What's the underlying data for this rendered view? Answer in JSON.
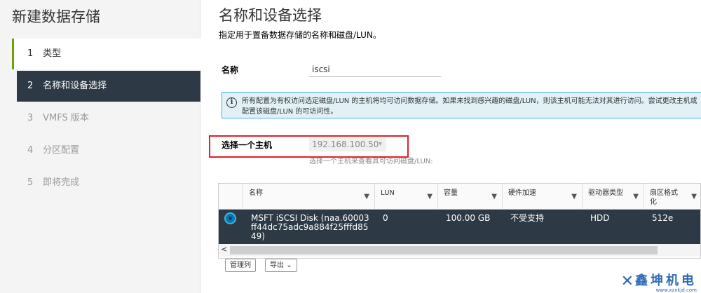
{
  "wizard": {
    "title": "新建数据存储",
    "steps": [
      {
        "num": "1",
        "label": "类型"
      },
      {
        "num": "2",
        "label": "名称和设备选择"
      },
      {
        "num": "3",
        "label": "VMFS 版本"
      },
      {
        "num": "4",
        "label": "分区配置"
      },
      {
        "num": "5",
        "label": "即将完成"
      }
    ]
  },
  "page": {
    "title": "名称和设备选择",
    "description": "指定用于置备数据存储的名称和磁盘/LUN。"
  },
  "form": {
    "name_label": "名称",
    "name_value": "iscsi",
    "info_text": "所有配置为有权访问选定磁盘/LUN 的主机将均可访问数据存储。如果未找到感兴趣的磁盘/LUN，则该主机可能无法对其进行访问。尝试更改主机或配置该磁盘/LUN 的可访问性。",
    "host_label": "选择一个主机",
    "host_value": "192.168.100.50",
    "host_hint": "选择一个主机来查看其可访问磁盘/LUN:"
  },
  "table": {
    "columns": [
      {
        "label": "名称"
      },
      {
        "label": "LUN"
      },
      {
        "label": "容量"
      },
      {
        "label": "硬件加速"
      },
      {
        "label": "驱动器类型"
      },
      {
        "label": "扇区格式化"
      }
    ],
    "rows": [
      {
        "name": "MSFT iSCSI Disk (naa.60003ff44dc75adc9a884f25fffd8549)",
        "lun": "0",
        "capacity": "100.00 GB",
        "hw_accel": "不受支持",
        "drive_type": "HDD",
        "sector_format": "512e",
        "selected": true
      }
    ],
    "manage_columns_label": "管理列",
    "export_label": "导出"
  },
  "watermark": {
    "text": "鑫坤机电",
    "url": "www.xzxkjd.com"
  },
  "colors": {
    "selected_row_bg": "#2d3a45",
    "done_step_accent": "#6ea204",
    "info_border": "#49afd9",
    "highlight_box": "#e0202a"
  }
}
